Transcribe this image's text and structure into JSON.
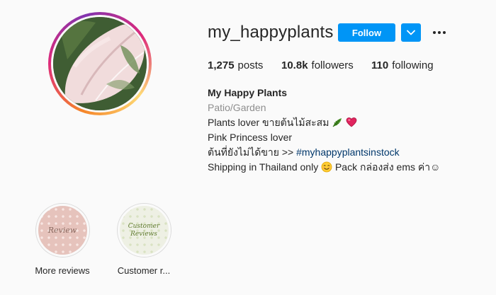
{
  "profile": {
    "username": "my_happyplants",
    "follow_label": "Follow",
    "avatar_alt": "profile-photo-pink-leaf"
  },
  "stats": {
    "posts_count": "1,275",
    "posts_label": "posts",
    "followers_count": "10.8k",
    "followers_label": "followers",
    "following_count": "110",
    "following_label": "following"
  },
  "bio": {
    "name": "My Happy Plants",
    "category": "Patio/Garden",
    "line1_text": "Plants lover ขายต้นไม้สะสม",
    "line2_text": "Pink Princess lover",
    "line3_prefix": "ต้นที่ยังไม่ได้ขาย >> ",
    "line3_hashtag": "#myhappyplantsinstock",
    "line4_part1": "Shipping in Thailand only ",
    "line4_part2": " Pack กล่องส่ง ems ค่า☺"
  },
  "highlights": [
    {
      "label": "More reviews",
      "cover_text": "Review"
    },
    {
      "label": "Customer r...",
      "cover_text_1": "Customer",
      "cover_text_2": "Reviews"
    }
  ],
  "colors": {
    "accent": "#0095f6",
    "hashtag": "#00376b",
    "muted": "#8e8e8e",
    "text": "#262626",
    "background": "#fafafa"
  },
  "icons": {
    "dropdown": "chevron-down-icon",
    "more": "more-options-icon",
    "leaf": "leaf-emoji-icon",
    "heart": "heart-emoji-icon",
    "smile": "smile-emoji-icon"
  }
}
